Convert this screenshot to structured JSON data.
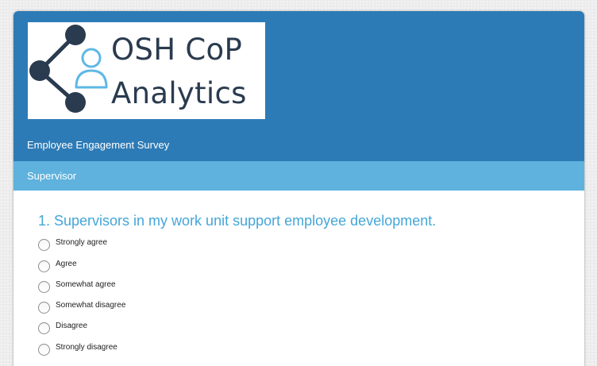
{
  "header": {
    "logo_line1": "OSH CoP",
    "logo_line2": "Analytics",
    "survey_title": "Employee Engagement Survey"
  },
  "section": {
    "title": "Supervisor"
  },
  "question": {
    "text": "1. Supervisors in my work unit support employee development.",
    "options": [
      "Strongly agree",
      "Agree",
      "Somewhat agree",
      "Somewhat disagree",
      "Disagree",
      "Strongly disagree"
    ]
  },
  "colors": {
    "header_bg": "#2d7bb6",
    "section_bg": "#5eb2dd",
    "question_text": "#44a6d8",
    "logo_dark": "#2a3b4f",
    "logo_accent": "#5eb8e6"
  }
}
